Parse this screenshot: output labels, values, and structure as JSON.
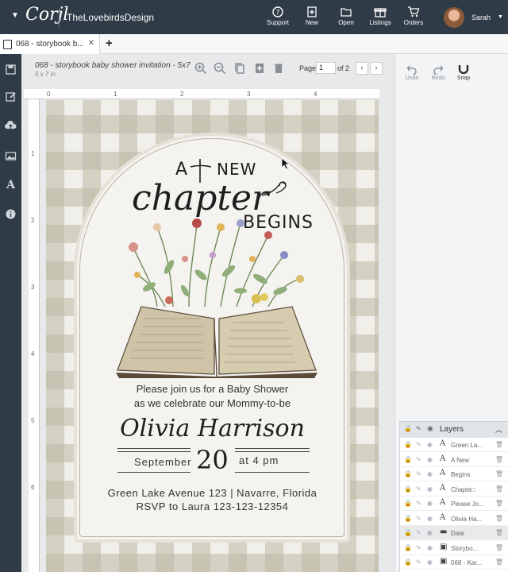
{
  "topbar": {
    "logo": "Corjl",
    "shop": "TheLovebirdsDesign",
    "buttons": [
      {
        "label": "Support",
        "icon": "help-circle-icon"
      },
      {
        "label": "New",
        "icon": "new-file-icon"
      },
      {
        "label": "Open",
        "icon": "folder-icon"
      },
      {
        "label": "Listings",
        "icon": "gift-icon"
      },
      {
        "label": "Orders",
        "icon": "cart-icon"
      }
    ],
    "user": "Sarah"
  },
  "tabs": {
    "active_tab": "068 - storybook b...",
    "new_tab": "+"
  },
  "canvas": {
    "title": "068 - storybook baby shower invitation - 5x7",
    "size": "5 x 7 in",
    "page_label": "Page",
    "page_value": "1",
    "of_label": "of 2",
    "ruler_marks": [
      "0",
      "1",
      "2",
      "3",
      "4"
    ],
    "vruler_marks": [
      "1",
      "2",
      "3",
      "4",
      "5",
      "6"
    ]
  },
  "invitation": {
    "line_a": "A",
    "line_new": "NEW",
    "line_chapter": "chapter",
    "line_begins": "BEGINS",
    "join_line1": "Please join us for a Baby Shower",
    "join_line2": "as we celebrate our Mommy-to-be",
    "name": "Olivia Harrison",
    "month": "September",
    "day": "20",
    "time": "at 4 pm",
    "address": "Green Lake Avenue 123 | Navarre, Florida",
    "rsvp": "RSVP to Laura 123-123-12354"
  },
  "right_panel": {
    "undo": "Undo",
    "redo": "Redo",
    "snap": "Snap"
  },
  "layers": {
    "title": "Layers",
    "items": [
      {
        "type": "A",
        "name": "Green La..."
      },
      {
        "type": "A",
        "name": "A     New"
      },
      {
        "type": "A",
        "name": "Begins"
      },
      {
        "type": "A",
        "name": "Chapte□"
      },
      {
        "type": "A",
        "name": "Please Jo..."
      },
      {
        "type": "A",
        "name": "Olivia Ha..."
      },
      {
        "type": "folder",
        "name": "Date"
      },
      {
        "type": "image",
        "name": "Storybo..."
      },
      {
        "type": "image",
        "name": "068 - Kar..."
      }
    ]
  },
  "colors": {
    "topbar": "#2f3b47",
    "gingham": "#d8d5c7",
    "arch": "#f4f3ef"
  }
}
